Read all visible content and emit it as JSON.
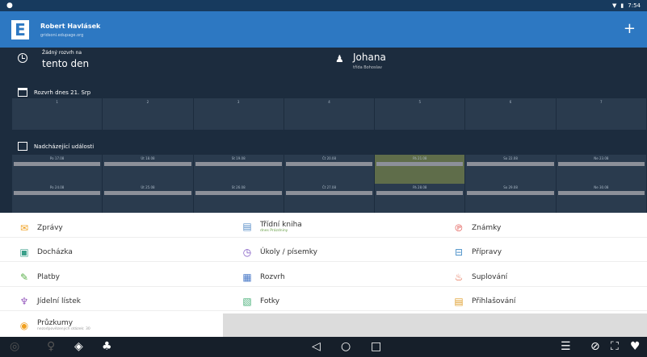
{
  "statusbar": {
    "time": "7:54",
    "left_icon": "circle-icon",
    "wifi_icon": "wifi-icon",
    "battery_icon": "battery-icon"
  },
  "appbar": {
    "logo": "E",
    "user_name": "Robert Havlásek",
    "user_sub": "gridsoni.edupage.org",
    "add_icon": "plus-icon"
  },
  "info": {
    "no_lessons_small": "Žádný rozvrh na",
    "no_lessons_big": "tento den",
    "teacher_name": "Johana",
    "teacher_sub": "třída Bohoslav"
  },
  "schedule": {
    "title": "Rozvrh dnes 21. Srp",
    "columns": [
      "1",
      "2",
      "3",
      "4",
      "5",
      "6",
      "7"
    ]
  },
  "events": {
    "title": "Nadcházející události",
    "row1": [
      "Po 17.08",
      "Út 18.08",
      "St 19.08",
      "Čt 20.08",
      "Pá 21.08",
      "So 22.08",
      "Ne 23.08"
    ],
    "row2": [
      "Po 24.08",
      "Út 25.08",
      "St 26.08",
      "Čt 27.08",
      "Pá 28.08",
      "So 29.08",
      "Ne 30.08"
    ]
  },
  "menu": {
    "zpravy": "Zprávy",
    "tridni_kniha": "Třídní kniha",
    "tridni_kniha_sub": "dnes Prázdniny",
    "znamky": "Známky",
    "dochazka": "Docházka",
    "ukoly": "Úkoly / písemky",
    "pripravy": "Přípravy",
    "platby": "Platby",
    "rozvrh": "Rozvrh",
    "suplovani": "Suplování",
    "jidelni_listek": "Jídelní lístek",
    "fotky": "Fotky",
    "prihlasovani": "Přihlašování",
    "pruzkumy": "Průzkumy",
    "pruzkumy_sub": "nezodpovězených otázek: 30"
  },
  "colors": {
    "appbar": "#2d78c2",
    "dark": "#1c2c3e",
    "highlight": "#5f6d4a"
  }
}
